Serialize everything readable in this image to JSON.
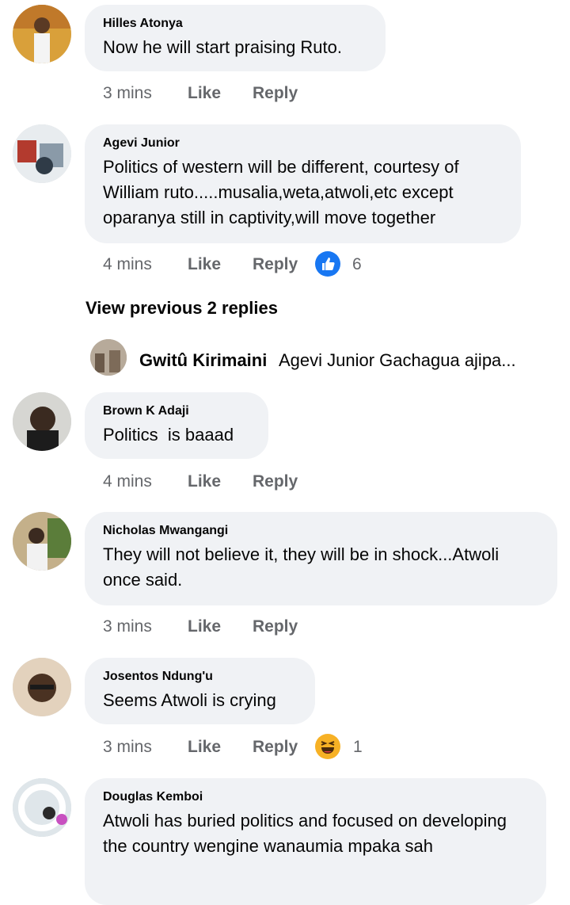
{
  "comments": [
    {
      "name": "Hilles Atonya",
      "text": "Now he will start praising Ruto.",
      "time": "3 mins",
      "like": "Like",
      "reply": "Reply"
    },
    {
      "name": "Agevi Junior",
      "text": "Politics of western will be different, courtesy of William ruto.....musalia,weta,atwoli,etc except oparanya still in captivity,will move together",
      "time": "4 mins",
      "like": "Like",
      "reply": "Reply",
      "reaction": {
        "icon": "like-thumb-icon",
        "count": "6",
        "color": "#1877f2"
      }
    },
    {
      "name": "Brown K Adaji",
      "text": "Politics  is baaad",
      "time": "4 mins",
      "like": "Like",
      "reply": "Reply"
    },
    {
      "name": "Nicholas Mwangangi",
      "text": "They will not believe it, they will be in shock...Atwoli once said.",
      "time": "3 mins",
      "like": "Like",
      "reply": "Reply"
    },
    {
      "name": "Josentos Ndung'u",
      "text": "Seems Atwoli is crying",
      "time": "3 mins",
      "like": "Like",
      "reply": "Reply",
      "reaction": {
        "icon": "haha-emoji-icon",
        "count": "1",
        "color": "#f7b125"
      }
    },
    {
      "name": "Douglas Kemboi",
      "text": "Atwoli has buried politics and focused on developing the country wengine wanaumia mpaka sah"
    }
  ],
  "thread": {
    "view_previous": "View previous 2 replies",
    "reply_preview": {
      "name": "Gwitû Kirimaini",
      "text": "Agevi Junior Gachagua ajipa..."
    }
  },
  "colors": {
    "bubble": "#f0f2f5",
    "meta": "#65676b",
    "like_blue": "#1877f2",
    "haha_yellow": "#f7b125"
  }
}
